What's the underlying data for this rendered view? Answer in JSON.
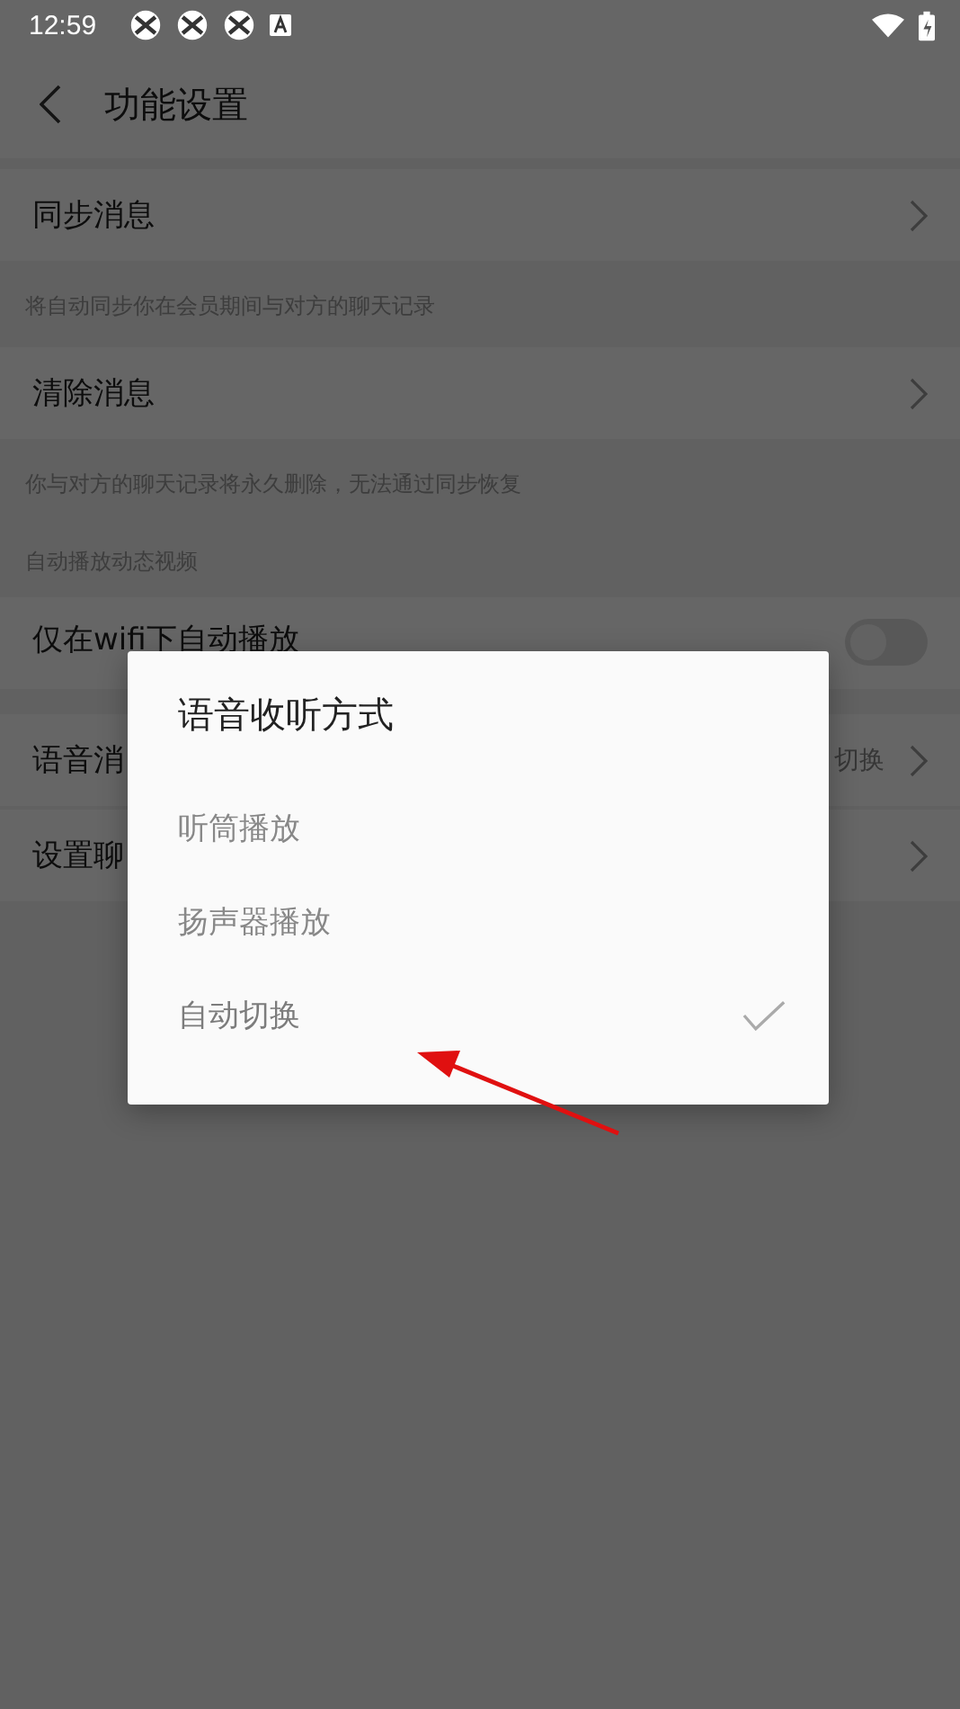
{
  "status_bar": {
    "time": "12:59"
  },
  "app_bar": {
    "title": "功能设置"
  },
  "settings": [
    {
      "kind": "link",
      "label": "同步消息"
    },
    {
      "kind": "note",
      "text": "将自动同步你在会员期间与对方的聊天记录"
    },
    {
      "kind": "link",
      "label": "清除消息"
    },
    {
      "kind": "note",
      "text": "你与对方的聊天记录将永久删除，无法通过同步恢复"
    },
    {
      "kind": "header",
      "text": "自动播放动态视频"
    },
    {
      "kind": "toggle",
      "label": "仅在wifi下自动播放",
      "on": false
    },
    {
      "kind": "link",
      "label": "语音消",
      "value": "切换"
    },
    {
      "kind": "link",
      "label": "设置聊"
    }
  ],
  "dialog": {
    "title": "语音收听方式",
    "options": [
      {
        "label": "听筒播放",
        "selected": false
      },
      {
        "label": "扬声器播放",
        "selected": false
      },
      {
        "label": "自动切换",
        "selected": true
      }
    ]
  }
}
